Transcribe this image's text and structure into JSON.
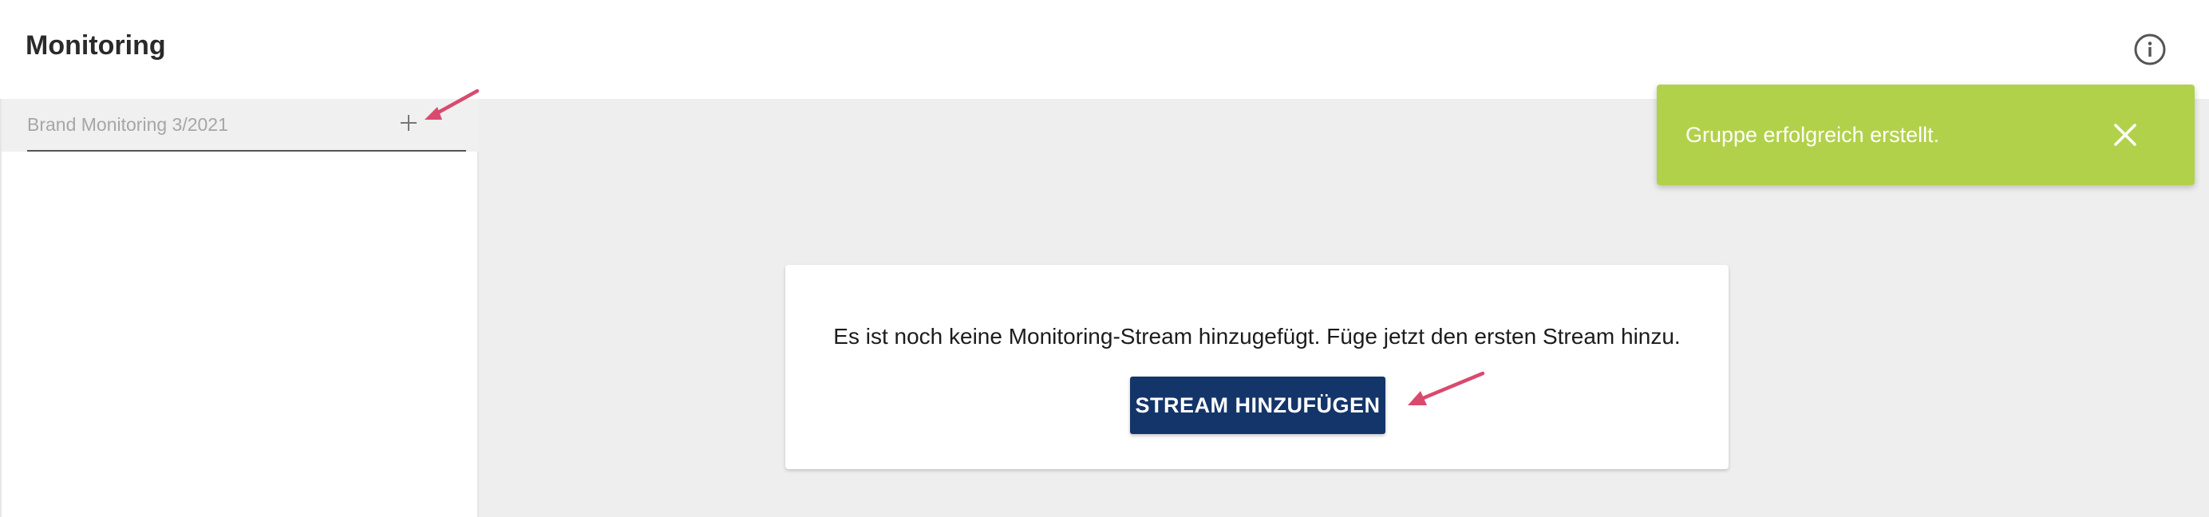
{
  "header": {
    "title": "Monitoring",
    "info_icon": "info-circle-icon"
  },
  "sidebar": {
    "group_input": {
      "value": "",
      "placeholder": "Brand Monitoring 3/2021"
    },
    "add_icon": "plus-icon"
  },
  "main": {
    "empty_message": "Es ist noch keine Monitoring-Stream hinzugefügt. Füge jetzt den ersten Stream hinzu.",
    "add_stream_label": "STREAM HINZUFÜGEN"
  },
  "toast": {
    "message": "Gruppe erfolgreich erstellt.",
    "close_icon": "close-icon"
  },
  "colors": {
    "primary_button": "#14356a",
    "toast_success": "#b2d14a",
    "annotation_arrow": "#d94a6e",
    "content_background": "#eeeeee"
  }
}
